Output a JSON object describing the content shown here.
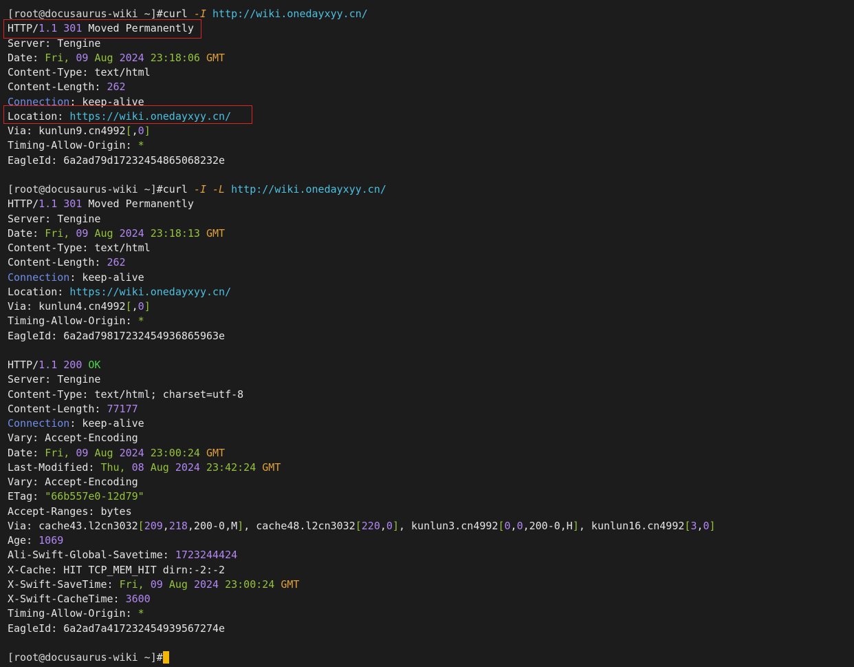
{
  "prompt": {
    "user_host": "[root@docusaurus-wiki ~]",
    "hash": "#"
  },
  "lines": [
    {
      "type": "prompt",
      "segs": [
        [
          "pr",
          "[root@docusaurus-wiki ~]"
        ],
        [
          "w",
          "#curl "
        ],
        [
          "o it",
          "-I "
        ],
        [
          "c",
          "http://wiki.onedayxyy.cn/"
        ]
      ]
    },
    {
      "type": "text",
      "segs": [
        [
          "w",
          "HTTP/"
        ],
        [
          "p",
          "1.1 301 "
        ],
        [
          "w",
          "Moved Permanently"
        ]
      ]
    },
    {
      "type": "text",
      "segs": [
        [
          "w",
          "Server: Tengine"
        ]
      ]
    },
    {
      "type": "text",
      "segs": [
        [
          "w",
          "Date: "
        ],
        [
          "g",
          "Fri, "
        ],
        [
          "p",
          "09 "
        ],
        [
          "g",
          "Aug "
        ],
        [
          "p",
          "2024 "
        ],
        [
          "g",
          "23:18:06 "
        ],
        [
          "or",
          "GMT"
        ]
      ]
    },
    {
      "type": "text",
      "segs": [
        [
          "w",
          "Content-Type: text/html"
        ]
      ]
    },
    {
      "type": "text",
      "segs": [
        [
          "w",
          "Content-Length: "
        ],
        [
          "p",
          "262"
        ]
      ]
    },
    {
      "type": "text",
      "segs": [
        [
          "kb",
          "Connection"
        ],
        [
          "w",
          ": keep-alive"
        ]
      ]
    },
    {
      "type": "text",
      "segs": [
        [
          "w",
          "Location: "
        ],
        [
          "c",
          "https://wiki.onedayxyy.cn/"
        ]
      ]
    },
    {
      "type": "text",
      "segs": [
        [
          "w",
          "Via: kunlun9.cn4992"
        ],
        [
          "g",
          "["
        ],
        [
          "w",
          ","
        ],
        [
          "p",
          "0"
        ],
        [
          "g",
          "]"
        ]
      ]
    },
    {
      "type": "text",
      "segs": [
        [
          "w",
          "Timing-Allow-Origin: "
        ],
        [
          "g",
          "*"
        ]
      ]
    },
    {
      "type": "text",
      "segs": [
        [
          "w",
          "EagleId: 6a2ad79d17232454865068232e"
        ]
      ]
    },
    {
      "type": "blank",
      "segs": []
    },
    {
      "type": "prompt",
      "segs": [
        [
          "pr",
          "[root@docusaurus-wiki ~]"
        ],
        [
          "w",
          "#curl "
        ],
        [
          "o it",
          "-I -L "
        ],
        [
          "c",
          "http://wiki.onedayxyy.cn/"
        ]
      ]
    },
    {
      "type": "text",
      "segs": [
        [
          "w",
          "HTTP/"
        ],
        [
          "p",
          "1.1 301 "
        ],
        [
          "w",
          "Moved Permanently"
        ]
      ]
    },
    {
      "type": "text",
      "segs": [
        [
          "w",
          "Server: Tengine"
        ]
      ]
    },
    {
      "type": "text",
      "segs": [
        [
          "w",
          "Date: "
        ],
        [
          "g",
          "Fri, "
        ],
        [
          "p",
          "09 "
        ],
        [
          "g",
          "Aug "
        ],
        [
          "p",
          "2024 "
        ],
        [
          "g",
          "23:18:13 "
        ],
        [
          "or",
          "GMT"
        ]
      ]
    },
    {
      "type": "text",
      "segs": [
        [
          "w",
          "Content-Type: text/html"
        ]
      ]
    },
    {
      "type": "text",
      "segs": [
        [
          "w",
          "Content-Length: "
        ],
        [
          "p",
          "262"
        ]
      ]
    },
    {
      "type": "text",
      "segs": [
        [
          "kb",
          "Connection"
        ],
        [
          "w",
          ": keep-alive"
        ]
      ]
    },
    {
      "type": "text",
      "segs": [
        [
          "w",
          "Location: "
        ],
        [
          "c",
          "https://wiki.onedayxyy.cn/"
        ]
      ]
    },
    {
      "type": "text",
      "segs": [
        [
          "w",
          "Via: kunlun4.cn4992"
        ],
        [
          "g",
          "["
        ],
        [
          "w",
          ","
        ],
        [
          "p",
          "0"
        ],
        [
          "g",
          "]"
        ]
      ]
    },
    {
      "type": "text",
      "segs": [
        [
          "w",
          "Timing-Allow-Origin: "
        ],
        [
          "g",
          "*"
        ]
      ]
    },
    {
      "type": "text",
      "segs": [
        [
          "w",
          "EagleId: 6a2ad79817232454936865963e"
        ]
      ]
    },
    {
      "type": "blank",
      "segs": []
    },
    {
      "type": "text",
      "segs": [
        [
          "w",
          "HTTP/"
        ],
        [
          "p",
          "1.1 200 "
        ],
        [
          "gr",
          "OK"
        ]
      ]
    },
    {
      "type": "text",
      "segs": [
        [
          "w",
          "Server: Tengine"
        ]
      ]
    },
    {
      "type": "text",
      "segs": [
        [
          "w",
          "Content-Type: text/html; charset=utf-8"
        ]
      ]
    },
    {
      "type": "text",
      "segs": [
        [
          "w",
          "Content-Length: "
        ],
        [
          "p",
          "77177"
        ]
      ]
    },
    {
      "type": "text",
      "segs": [
        [
          "kb",
          "Connection"
        ],
        [
          "w",
          ": keep-alive"
        ]
      ]
    },
    {
      "type": "text",
      "segs": [
        [
          "w",
          "Vary: Accept-Encoding"
        ]
      ]
    },
    {
      "type": "text",
      "segs": [
        [
          "w",
          "Date: "
        ],
        [
          "g",
          "Fri, "
        ],
        [
          "p",
          "09 "
        ],
        [
          "g",
          "Aug "
        ],
        [
          "p",
          "2024 "
        ],
        [
          "g",
          "23:00:24 "
        ],
        [
          "or",
          "GMT"
        ]
      ]
    },
    {
      "type": "text",
      "segs": [
        [
          "w",
          "Last-Modified: "
        ],
        [
          "g",
          "Thu, "
        ],
        [
          "p",
          "08 "
        ],
        [
          "g",
          "Aug "
        ],
        [
          "p",
          "2024 "
        ],
        [
          "g",
          "23:42:24 "
        ],
        [
          "or",
          "GMT"
        ]
      ]
    },
    {
      "type": "text",
      "segs": [
        [
          "w",
          "Vary: Accept-Encoding"
        ]
      ]
    },
    {
      "type": "text",
      "segs": [
        [
          "w",
          "ETag: "
        ],
        [
          "g",
          "\"66b557e0-12d79\""
        ]
      ]
    },
    {
      "type": "text",
      "segs": [
        [
          "w",
          "Accept-Ranges: bytes"
        ]
      ]
    },
    {
      "type": "text",
      "segs": [
        [
          "w",
          "Via: cache43.l2cn3032"
        ],
        [
          "g",
          "["
        ],
        [
          "p",
          "209"
        ],
        [
          "w",
          ","
        ],
        [
          "p",
          "218"
        ],
        [
          "w",
          ",200-0,M"
        ],
        [
          "g",
          "]"
        ],
        [
          "w",
          ", cache48.l2cn3032"
        ],
        [
          "g",
          "["
        ],
        [
          "p",
          "220"
        ],
        [
          "w",
          ","
        ],
        [
          "p",
          "0"
        ],
        [
          "g",
          "]"
        ],
        [
          "w",
          ", kunlun3.cn4992"
        ],
        [
          "g",
          "["
        ],
        [
          "p",
          "0"
        ],
        [
          "w",
          ","
        ],
        [
          "p",
          "0"
        ],
        [
          "w",
          ",200-0,H"
        ],
        [
          "g",
          "]"
        ],
        [
          "w",
          ", kunlun16.cn4992"
        ],
        [
          "g",
          "["
        ],
        [
          "p",
          "3"
        ],
        [
          "w",
          ","
        ],
        [
          "p",
          "0"
        ],
        [
          "g",
          "]"
        ]
      ]
    },
    {
      "type": "text",
      "segs": [
        [
          "w",
          "Age: "
        ],
        [
          "p",
          "1069"
        ]
      ]
    },
    {
      "type": "text",
      "segs": [
        [
          "w",
          "Ali-Swift-Global-Savetime: "
        ],
        [
          "p",
          "1723244424"
        ]
      ]
    },
    {
      "type": "text",
      "segs": [
        [
          "w",
          "X-Cache: HIT TCP_MEM_HIT dirn:-2:-2"
        ]
      ]
    },
    {
      "type": "text",
      "segs": [
        [
          "w",
          "X-Swift-SaveTime: "
        ],
        [
          "g",
          "Fri, "
        ],
        [
          "p",
          "09 "
        ],
        [
          "g",
          "Aug "
        ],
        [
          "p",
          "2024 "
        ],
        [
          "g",
          "23:00:24 "
        ],
        [
          "or",
          "GMT"
        ]
      ]
    },
    {
      "type": "text",
      "segs": [
        [
          "w",
          "X-Swift-CacheTime: "
        ],
        [
          "p",
          "3600"
        ]
      ]
    },
    {
      "type": "text",
      "segs": [
        [
          "w",
          "Timing-Allow-Origin: "
        ],
        [
          "g",
          "*"
        ]
      ]
    },
    {
      "type": "text",
      "segs": [
        [
          "w",
          "EagleId: 6a2ad7a417232454939567274e"
        ]
      ]
    },
    {
      "type": "blank",
      "segs": []
    },
    {
      "type": "prompt",
      "segs": [
        [
          "pr",
          "[root@docusaurus-wiki ~]"
        ],
        [
          "w",
          "#"
        ]
      ],
      "cursor": true
    }
  ],
  "colors": {
    "background": "#1c1c1c",
    "highlight_border": "#e02424",
    "cursor": "#f2b705"
  }
}
